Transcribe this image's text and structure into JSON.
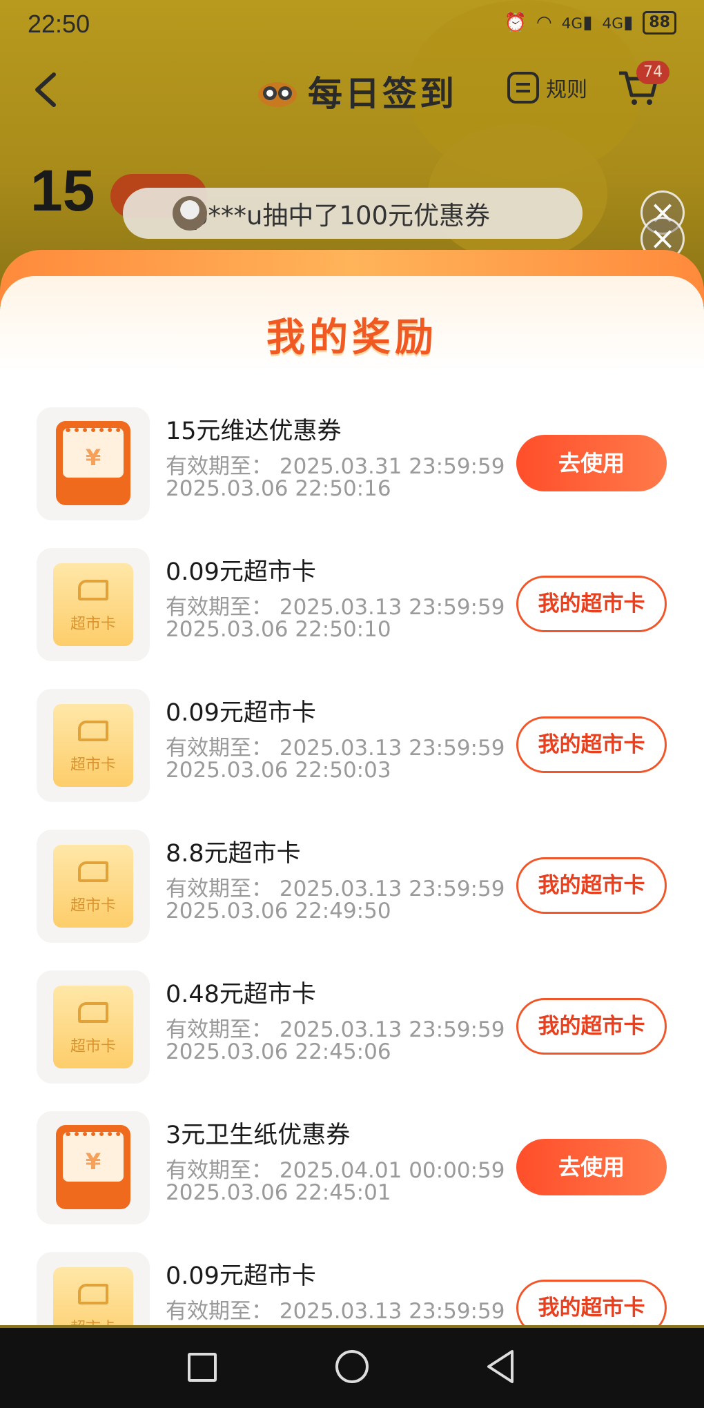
{
  "status_bar": {
    "time": "22:50",
    "battery": "88",
    "signal_1": "4G",
    "signal_2": "4G"
  },
  "header": {
    "title": "每日签到",
    "rules_label": "规则",
    "cart_badge": "74"
  },
  "background": {
    "points": "15"
  },
  "toast": {
    "text": "p***u抽中了100元优惠券"
  },
  "panel": {
    "title": "我的奖励",
    "items": [
      {
        "name": "15元维达优惠券",
        "expiry": "有效期至：   2025.03.31 23:59:59",
        "time": "2025.03.06 22:50:16",
        "icon": "coupon-icon",
        "button": "去使用"
      },
      {
        "name": "0.09元超市卡",
        "expiry": "有效期至：   2025.03.13 23:59:59",
        "time": "2025.03.06 22:50:10",
        "icon": "supermarket-card-icon",
        "icon_label": "超市卡",
        "button": "我的超市卡"
      },
      {
        "name": "0.09元超市卡",
        "expiry": "有效期至：   2025.03.13 23:59:59",
        "time": "2025.03.06 22:50:03",
        "icon": "supermarket-card-icon",
        "icon_label": "超市卡",
        "button": "我的超市卡"
      },
      {
        "name": "8.8元超市卡",
        "expiry": "有效期至：   2025.03.13 23:59:59",
        "time": "2025.03.06 22:49:50",
        "icon": "supermarket-card-icon",
        "icon_label": "超市卡",
        "button": "我的超市卡"
      },
      {
        "name": "0.48元超市卡",
        "expiry": "有效期至：   2025.03.13 23:59:59",
        "time": "2025.03.06 22:45:06",
        "icon": "supermarket-card-icon",
        "icon_label": "超市卡",
        "button": "我的超市卡"
      },
      {
        "name": "3元卫生纸优惠券",
        "expiry": "有效期至：   2025.04.01 00:00:59",
        "time": "2025.03.06 22:45:01",
        "icon": "coupon-icon",
        "button": "去使用"
      },
      {
        "name": "0.09元超市卡",
        "expiry": "有效期至：   2025.03.13 23:59:59",
        "time": "",
        "icon": "supermarket-card-icon",
        "icon_label": "超市卡",
        "button": "我的超市卡"
      }
    ]
  },
  "colors": {
    "accent": "#f05a22",
    "button_gradient_start": "#ff4e2a",
    "button_gradient_end": "#ff7a4a",
    "dim_overlay": "#8a7318"
  }
}
